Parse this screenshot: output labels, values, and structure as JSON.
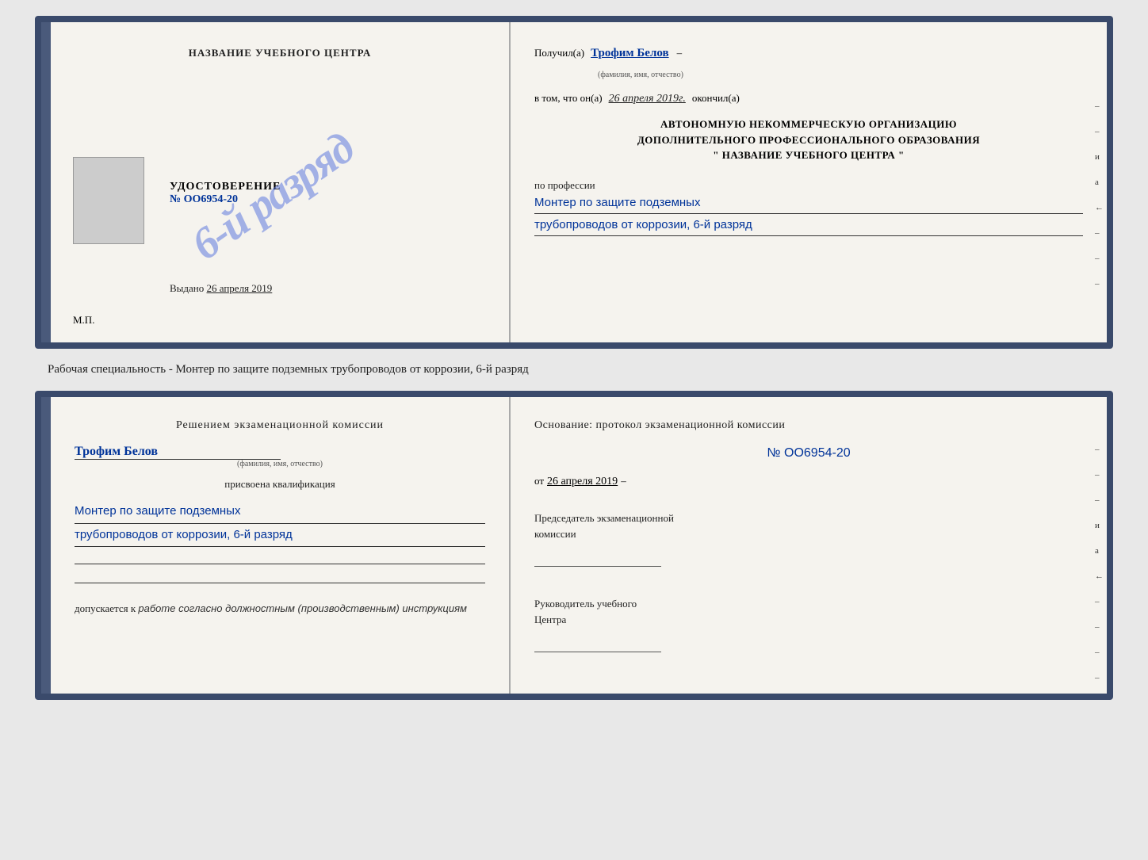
{
  "top_cert": {
    "left": {
      "title": "НАЗВАНИЕ УЧЕБНОГО ЦЕНТРА",
      "stamp_text": "6-й разряд",
      "udostoverenie_label": "УДОСТОВЕРЕНИЕ",
      "number": "№ OO6954-20",
      "vydano_label": "Выдано",
      "vydano_date": "26 апреля 2019",
      "mp": "М.П."
    },
    "right": {
      "poluchil_label": "Получил(a)",
      "poluchil_name": "Трофим Белов",
      "poluchil_sub": "(фамилия, имя, отчество)",
      "dash1": "–",
      "vtom_label": "в том, что он(а)",
      "vtom_date": "26 апреля 2019г.",
      "okonchil": "окончил(а)",
      "org_line1": "АВТОНОМНУЮ НЕКОММЕРЧЕСКУЮ ОРГАНИЗАЦИЮ",
      "org_line2": "ДОПОЛНИТЕЛЬНОГО ПРОФЕССИОНАЛЬНОГО ОБРАЗОВАНИЯ",
      "org_name": "\" НАЗВАНИЕ УЧЕБНОГО ЦЕНТРА \"",
      "po_professii": "по профессии",
      "profession_line1": "Монтер по защите подземных",
      "profession_line2": "трубопроводов от коррозии, 6-й разряд",
      "side_marks": [
        "–",
        "–",
        "и",
        "а",
        "←",
        "–",
        "–",
        "–"
      ]
    }
  },
  "caption": "Рабочая специальность - Монтер по защите подземных трубопроводов от коррозии, 6-й разряд",
  "bottom_cert": {
    "left": {
      "decision_title": "Решением экзаменационной комиссии",
      "name": "Трофим Белов",
      "name_sub": "(фамилия, имя, отчество)",
      "prisvoena": "присвоена квалификация",
      "qual_line1": "Монтер по защите подземных",
      "qual_line2": "трубопроводов от коррозии, 6-й разряд",
      "dopusk_label": "допускается к",
      "dopusk_text": "работе согласно должностным (производственным) инструкциям"
    },
    "right": {
      "osnov_label": "Основание: протокол экзаменационной комиссии",
      "number": "№ OO6954-20",
      "ot_label": "от",
      "ot_date": "26 апреля 2019",
      "dash1": "–",
      "predsedatel_line1": "Председатель экзаменационной",
      "predsedatel_line2": "комиссии",
      "rukovoditel_line1": "Руководитель учебного",
      "rukovoditel_line2": "Центра",
      "side_marks": [
        "–",
        "–",
        "–",
        "и",
        "а",
        "←",
        "–",
        "–",
        "–",
        "–"
      ]
    }
  }
}
